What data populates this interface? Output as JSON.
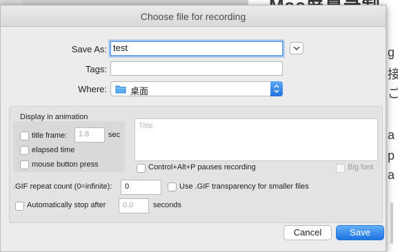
{
  "background": {
    "heading": "Mac屏幕录制",
    "glyphs": [
      "g",
      "接",
      "ご",
      "a",
      "p",
      "a"
    ]
  },
  "window": {
    "title": "Choose file for recording"
  },
  "save_as": {
    "label": "Save As:",
    "value": "test"
  },
  "tags": {
    "label": "Tags:",
    "value": ""
  },
  "where": {
    "label": "Where:",
    "value": "桌面",
    "icon": "folder-icon"
  },
  "animation": {
    "group_title": "Display in animation",
    "title_frame": {
      "label": "title frame:",
      "value": "1.8",
      "unit": "sec",
      "checked": false
    },
    "elapsed_time": {
      "label": "elapsed time",
      "checked": false
    },
    "mouse_button_press": {
      "label": "mouse button press",
      "checked": false
    },
    "title_text": {
      "placeholder": "Title"
    },
    "pause_hotkey": {
      "label": "Control+Alt+P pauses recording",
      "checked": false
    },
    "big_font": {
      "label": "Big font",
      "checked": false,
      "enabled": false
    }
  },
  "gif": {
    "repeat_label": ".GIF repeat count (0=infinite):",
    "repeat_value": "0",
    "transparency": {
      "label": "Use .GIF transparency for smaller files",
      "checked": false
    },
    "auto_stop": {
      "label": "Automatically stop after",
      "value": "0.0",
      "unit": "seconds",
      "checked": false
    }
  },
  "buttons": {
    "cancel": "Cancel",
    "save": "Save"
  },
  "colors": {
    "accent": "#1c73e1",
    "focus_ring": "#6aa5e9",
    "sheet_bg": "#ececec"
  }
}
